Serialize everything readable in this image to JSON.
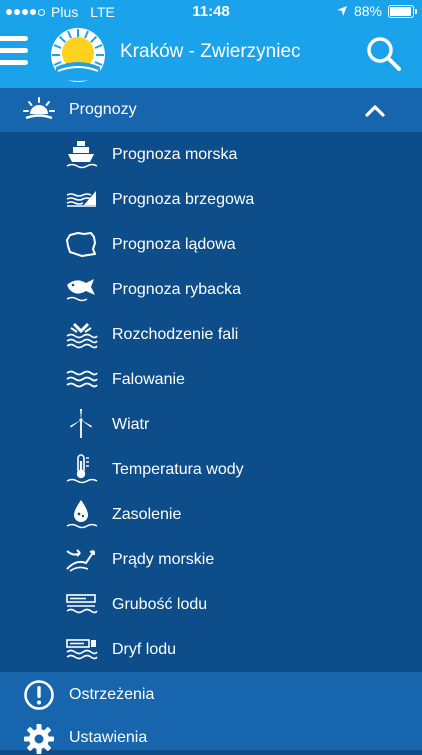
{
  "status": {
    "carrier": "Plus",
    "network": "LTE",
    "time": "11:48",
    "battery": "88%"
  },
  "header": {
    "title": "Kraków - Zwierzyniec"
  },
  "menu": {
    "section": {
      "label": "Prognozy",
      "icon": "sun-cloud-icon",
      "expanded": true
    },
    "items": [
      {
        "label": "Prognoza morska",
        "icon": "ship-icon"
      },
      {
        "label": "Prognoza brzegowa",
        "icon": "coast-icon"
      },
      {
        "label": "Prognoza lądowa",
        "icon": "poland-map-icon"
      },
      {
        "label": "Prognoza rybacka",
        "icon": "fish-icon"
      },
      {
        "label": "Rozchodzenie fali",
        "icon": "wave-spread-icon"
      },
      {
        "label": "Falowanie",
        "icon": "waves-icon"
      },
      {
        "label": "Wiatr",
        "icon": "wind-turbine-icon"
      },
      {
        "label": "Temperatura wody",
        "icon": "water-thermometer-icon"
      },
      {
        "label": "Zasolenie",
        "icon": "salinity-drop-icon"
      },
      {
        "label": "Prądy morskie",
        "icon": "sea-currents-icon"
      },
      {
        "label": "Grubość lodu",
        "icon": "ice-thickness-icon"
      },
      {
        "label": "Dryf lodu",
        "icon": "ice-drift-icon"
      }
    ],
    "bottom": [
      {
        "label": "Ostrzeżenia",
        "icon": "warning-icon"
      },
      {
        "label": "Ustawienia",
        "icon": "settings-gear-icon"
      }
    ]
  }
}
